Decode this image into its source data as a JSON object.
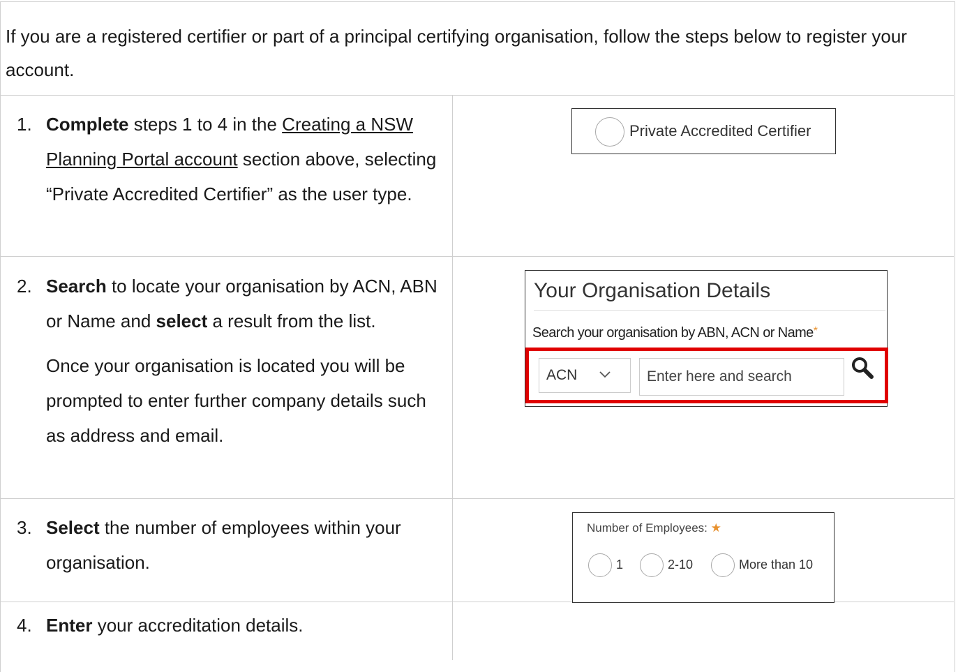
{
  "intro": "If you are a registered certifier or part of a principal certifying organisation, follow the steps below to register your account.",
  "steps": [
    {
      "number": "1.",
      "keyword": "Complete",
      "pre": " steps 1 to 4 in the ",
      "link": "Creating a NSW Planning Portal account",
      "post": " section above, selecting “Private Accredited Certifier” as the user type."
    },
    {
      "number": "2.",
      "keyword": "Search",
      "pre": " to locate your organisation by ACN, ABN or Name and ",
      "keyword2": "select",
      "post": " a result from the list.",
      "extra": "Once your organisation is located you will be prompted to enter further company details such as address and email."
    },
    {
      "number": "3.",
      "keyword": "Select",
      "post": " the number of employees within your organisation."
    },
    {
      "number": "4.",
      "keyword": "Enter",
      "post": " your accreditation details."
    }
  ],
  "screenshot1": {
    "radio_label": "Private Accredited Certifier"
  },
  "screenshot2": {
    "title": "Your Organisation Details",
    "search_label": "Search your organisation by ABN, ACN or Name",
    "required_mark": "*",
    "select_value": "ACN",
    "search_placeholder": "Enter here and search",
    "search_icon": "magnifier-icon",
    "highlight_color": "#e00000"
  },
  "screenshot3": {
    "label": "Number of Employees:",
    "required_mark": "★",
    "options": [
      "1",
      "2-10",
      "More than 10"
    ]
  }
}
